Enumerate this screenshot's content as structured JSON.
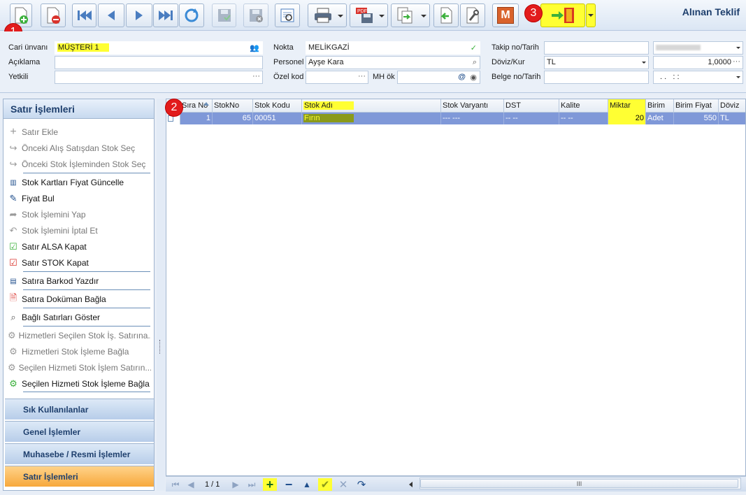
{
  "form_title": "Alınan Teklif",
  "toolbar": {
    "m_button_label": "M"
  },
  "badges": {
    "b1": "1",
    "b2": "2",
    "b3": "3"
  },
  "header": {
    "cari_unvani_label": "Cari ünvanı",
    "cari_unvani_value": "MÜŞTERİ 1",
    "aciklama_label": "Açıklama",
    "yetkili_label": "Yetkili",
    "nokta_label": "Nokta",
    "nokta_value": "MELİKGAZİ",
    "personel_label": "Personel",
    "personel_value": "Ayşe Kara",
    "ozel_kod_label": "Özel kod",
    "mh_ok_label": "MH ök",
    "takip_label": "Takip no/Tarih",
    "doviz_kur_label": "Döviz/Kur",
    "doviz_value": "TL",
    "kur_value": "1,0000",
    "belge_label": "Belge no/Tarih",
    "belge_date_value": ". .   : :"
  },
  "left_panel": {
    "title": "Satır İşlemleri",
    "items": [
      {
        "label": "Satır Ekle",
        "icon": "plus-icon"
      },
      {
        "label": "Önceki Alış Satışdan Stok Seç",
        "icon": "arrow-icon"
      },
      {
        "label": "Önceki Stok İşleminden Stok Seç",
        "icon": "arrow-icon"
      },
      {
        "label": "Stok Kartları Fiyat Güncelle",
        "icon": "barcode-icon"
      },
      {
        "label": "Fiyat Bul",
        "icon": "tag-icon"
      },
      {
        "label": "Stok İşlemini Yap",
        "icon": "share-icon"
      },
      {
        "label": "Stok İşlemini İptal Et",
        "icon": "undo-icon"
      },
      {
        "label": "Satır ALSA Kapat",
        "icon": "check-doc-icon"
      },
      {
        "label": "Satır STOK Kapat",
        "icon": "check-doc-red-icon"
      },
      {
        "label": "Satıra Barkod Yazdır",
        "icon": "barcode-print-icon"
      },
      {
        "label": "Satıra Doküman Bağla",
        "icon": "document-icon"
      },
      {
        "label": "Bağlı Satırları Göster",
        "icon": "magnifier-icon"
      },
      {
        "label": "Hizmetleri Seçilen Stok İş. Satırına...",
        "icon": "link-icon"
      },
      {
        "label": "Hizmetleri Stok İşleme Bağla",
        "icon": "link-icon"
      },
      {
        "label": "Seçilen Hizmeti Stok İşlem Satırın...",
        "icon": "link-icon"
      },
      {
        "label": "Seçilen Hizmeti Stok İşleme Bağla",
        "icon": "link-icon"
      }
    ],
    "groups": [
      "Sık Kullanılanlar",
      "Genel İşlemler",
      "Muhasebe / Resmi İşlemler",
      "Satır İşlemleri"
    ]
  },
  "grid": {
    "columns": [
      "Sıra No",
      "StokNo",
      "Stok Kodu",
      "Stok Adı",
      "Stok Varyantı",
      "DST",
      "Kalite",
      "Miktar",
      "Birim",
      "Birim Fiyat",
      "Döviz"
    ],
    "row": {
      "sira_no": "1",
      "stok_no": "65",
      "stok_kodu": "00051",
      "stok_adi": "Fırın",
      "stok_varyanti": "--- ---",
      "dst": "-- --",
      "kalite": "-- --",
      "miktar": "20",
      "birim": "Adet",
      "birim_fiyat": "550",
      "doviz": "TL"
    }
  },
  "navigator": {
    "page": "1 / 1",
    "scroll_grip": "III"
  },
  "colors": {
    "highlight": "#ffff33",
    "badge": "#e21c1c",
    "selected_row": "#7f98d8",
    "active_group": "#f7a83b"
  }
}
